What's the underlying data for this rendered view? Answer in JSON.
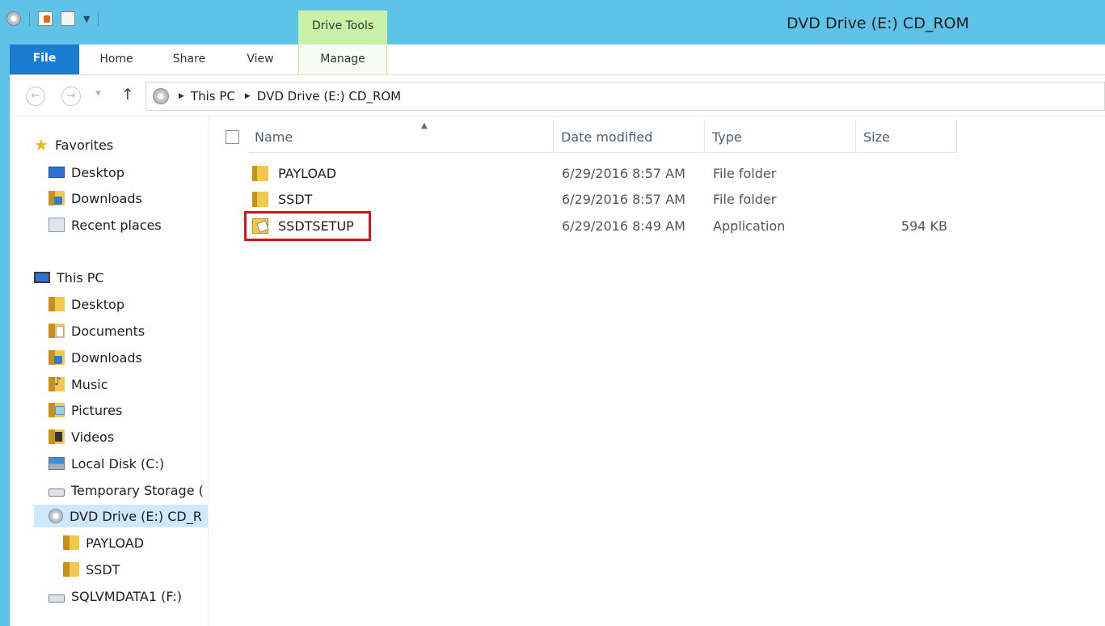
{
  "window": {
    "title": "DVD Drive (E:) CD_ROM",
    "tool_tab_header": "Drive Tools"
  },
  "ribbon": {
    "tabs": [
      "File",
      "Home",
      "Share",
      "View",
      "Manage"
    ]
  },
  "address_bar": {
    "crumbs": [
      "This PC",
      "DVD Drive (E:) CD_ROM"
    ]
  },
  "nav_pane": {
    "favorites_label": "Favorites",
    "favorites": [
      "Desktop",
      "Downloads",
      "Recent places"
    ],
    "this_pc_label": "This PC",
    "this_pc_items": [
      "Desktop",
      "Documents",
      "Downloads",
      "Music",
      "Pictures",
      "Videos",
      "Local Disk (C:)",
      "Temporary Storage (",
      "DVD Drive (E:) CD_R"
    ],
    "dvd_children": [
      "PAYLOAD",
      "SSDT"
    ],
    "other_drive": "SQLVMDATA1 (F:)"
  },
  "columns": {
    "name": "Name",
    "date": "Date modified",
    "type": "Type",
    "size": "Size"
  },
  "files": [
    {
      "name": "PAYLOAD",
      "date": "6/29/2016 8:57 AM",
      "type": "File folder",
      "size": ""
    },
    {
      "name": "SSDT",
      "date": "6/29/2016 8:57 AM",
      "type": "File folder",
      "size": ""
    },
    {
      "name": "SSDTSETUP",
      "date": "6/29/2016 8:49 AM",
      "type": "Application",
      "size": "594 KB"
    }
  ],
  "icons": {
    "folder": "folder-icon",
    "application": "application-icon",
    "dvd": "dvd-drive-icon"
  },
  "colors": {
    "titlebar": "#5fc3e8",
    "file_tab": "#1a7cd1",
    "tool_tab": "#c9f1a7",
    "highlight": "#d4141c",
    "selected": "#cde8ff"
  }
}
